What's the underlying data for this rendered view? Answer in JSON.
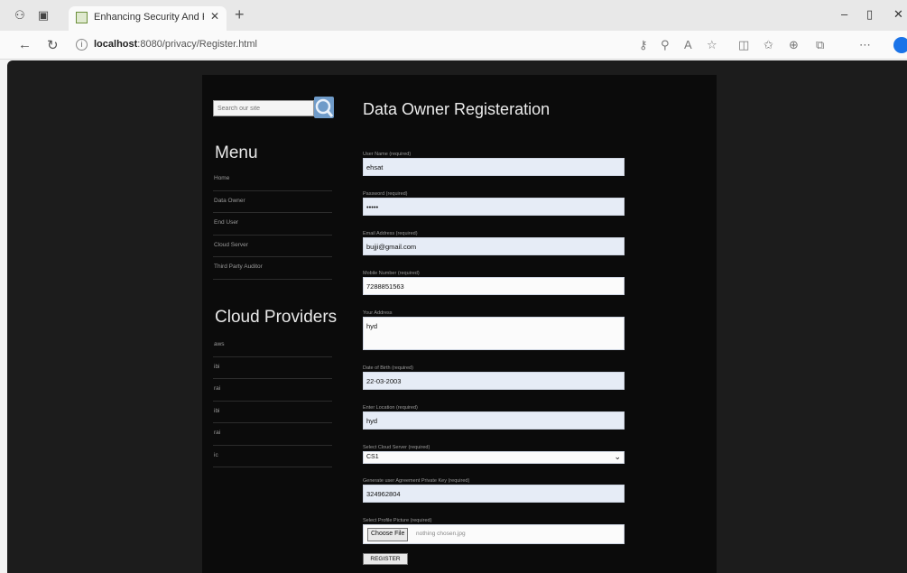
{
  "browser": {
    "tab_title": "Enhancing Security And Privacy",
    "url_host": "localhost",
    "url_path": ":8080/privacy/Register.html"
  },
  "sidebar": {
    "search_placeholder": "Search our site",
    "menu_heading": "Menu",
    "menu_items": [
      "Home",
      "Data Owner",
      "End User",
      "Cloud Server",
      "Third Party Auditor"
    ],
    "cloud_heading": "Cloud Providers",
    "cloud_items": [
      "aws",
      "ibi",
      "rai",
      "ibi",
      "rai",
      "ic"
    ]
  },
  "form": {
    "title": "Data Owner Registeration",
    "fields": {
      "username": {
        "label": "User Name (required)",
        "value": "ehsat"
      },
      "password": {
        "label": "Password (required)",
        "value": "•••••"
      },
      "email": {
        "label": "Email Address (required)",
        "value": "bujji@gmail.com"
      },
      "mobile": {
        "label": "Mobile Number (required)",
        "value": "7288851563"
      },
      "address": {
        "label": "Your Address",
        "value": "hyd"
      },
      "dob": {
        "label": "Date of Birth (required)",
        "value": "22-03-2003"
      },
      "location": {
        "label": "Enter Location (required)",
        "value": "hyd"
      },
      "cloud": {
        "label": "Select Cloud Server (required)",
        "value": "CS1"
      },
      "secret_key": {
        "label": "Generate user Agreement Private Key (required)",
        "value": "324962804"
      },
      "profile_pic": {
        "label": "Select Profile Picture (required)",
        "button": "Choose File",
        "file": "nothing chosen.jpg"
      }
    },
    "submit": "REGISTER"
  }
}
